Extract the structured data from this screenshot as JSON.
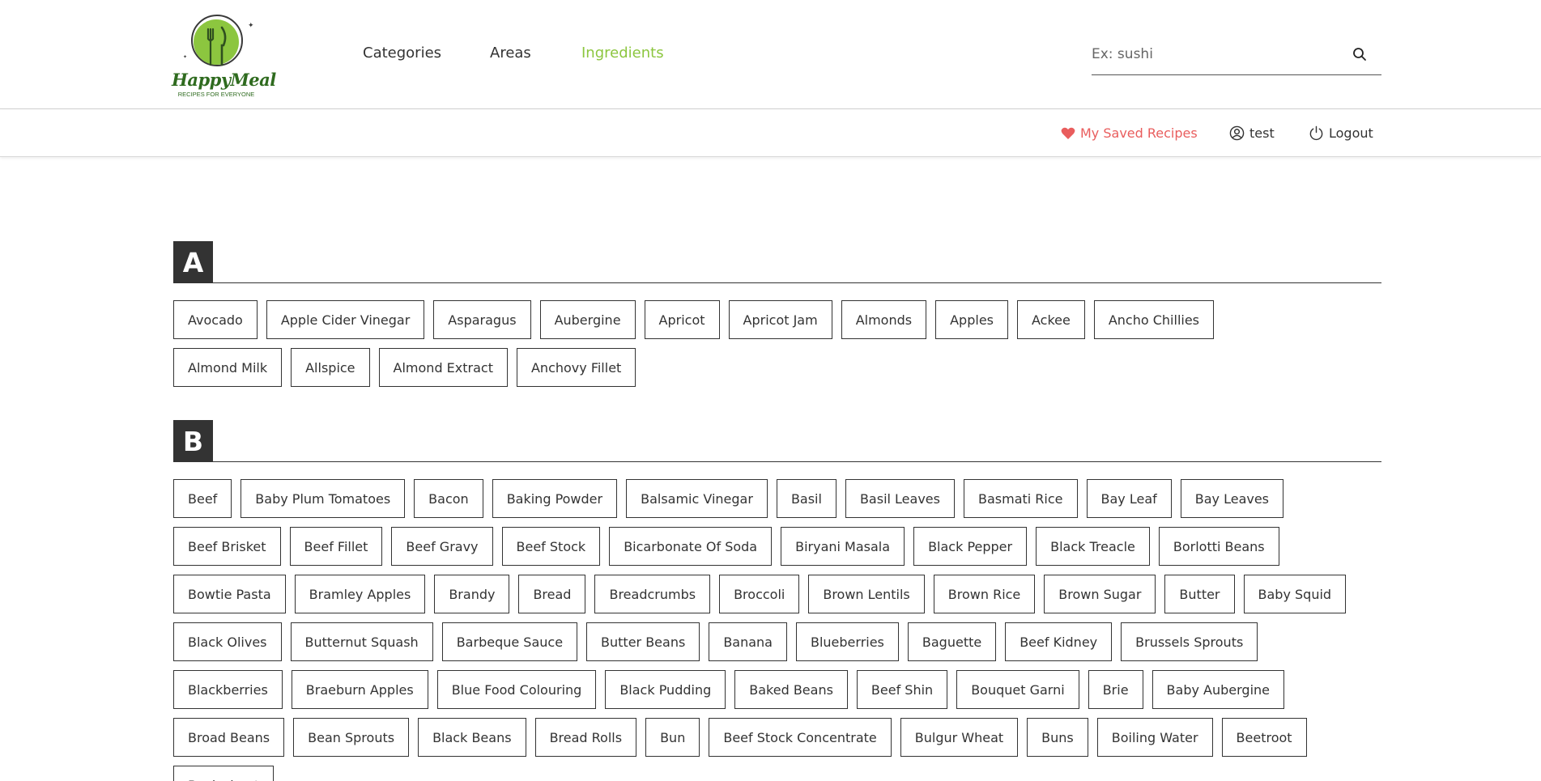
{
  "brand": {
    "name": "HappyMeal",
    "tagline": "RECIPES FOR EVERYONE"
  },
  "nav": {
    "categories": "Categories",
    "areas": "Areas",
    "ingredients": "Ingredients"
  },
  "search": {
    "placeholder": "Ex: sushi",
    "value": ""
  },
  "user_bar": {
    "saved": "My Saved Recipes",
    "user": "test",
    "logout": "Logout"
  },
  "colors": {
    "accent_green": "#8cc63f",
    "saved_red": "#e95d5d",
    "dark": "#333333"
  },
  "sections": [
    {
      "letter": "A",
      "items": [
        "Avocado",
        "Apple Cider Vinegar",
        "Asparagus",
        "Aubergine",
        "Apricot",
        "Apricot Jam",
        "Almonds",
        "Apples",
        "Ackee",
        "Ancho Chillies",
        "Almond Milk",
        "Allspice",
        "Almond Extract",
        "Anchovy Fillet"
      ]
    },
    {
      "letter": "B",
      "items": [
        "Beef",
        "Baby Plum Tomatoes",
        "Bacon",
        "Baking Powder",
        "Balsamic Vinegar",
        "Basil",
        "Basil Leaves",
        "Basmati Rice",
        "Bay Leaf",
        "Bay Leaves",
        "Beef Brisket",
        "Beef Fillet",
        "Beef Gravy",
        "Beef Stock",
        "Bicarbonate Of Soda",
        "Biryani Masala",
        "Black Pepper",
        "Black Treacle",
        "Borlotti Beans",
        "Bowtie Pasta",
        "Bramley Apples",
        "Brandy",
        "Bread",
        "Breadcrumbs",
        "Broccoli",
        "Brown Lentils",
        "Brown Rice",
        "Brown Sugar",
        "Butter",
        "Baby Squid",
        "Black Olives",
        "Butternut Squash",
        "Barbeque Sauce",
        "Butter Beans",
        "Banana",
        "Blueberries",
        "Baguette",
        "Beef Kidney",
        "Brussels Sprouts",
        "Blackberries",
        "Braeburn Apples",
        "Blue Food Colouring",
        "Black Pudding",
        "Baked Beans",
        "Beef Shin",
        "Bouquet Garni",
        "Brie",
        "Baby Aubergine",
        "Broad Beans",
        "Bean Sprouts",
        "Black Beans",
        "Bread Rolls",
        "Bun",
        "Beef Stock Concentrate",
        "Bulgur Wheat",
        "Buns",
        "Boiling Water",
        "Beetroot",
        "Buckwheat"
      ]
    }
  ]
}
